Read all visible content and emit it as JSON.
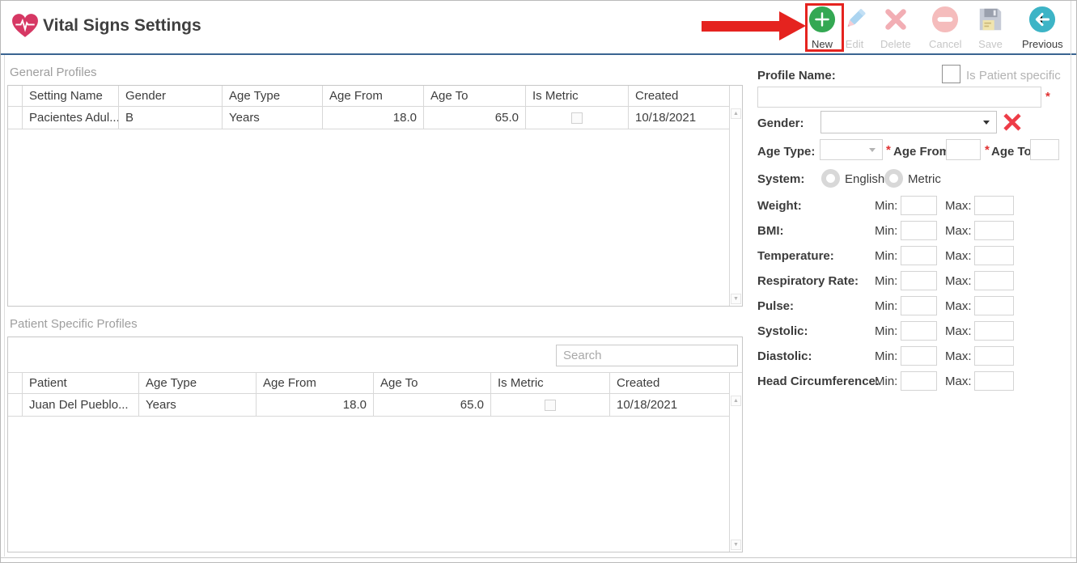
{
  "header": {
    "title": "Vital Signs Settings"
  },
  "toolbar": {
    "new": {
      "label": "New",
      "enabled": true
    },
    "edit": {
      "label": "Edit",
      "enabled": false
    },
    "delete": {
      "label": "Delete",
      "enabled": false
    },
    "cancel": {
      "label": "Cancel",
      "enabled": false
    },
    "save": {
      "label": "Save",
      "enabled": false
    },
    "previous": {
      "label": "Previous",
      "enabled": true
    }
  },
  "annotation": {
    "highlighted_button": "New"
  },
  "general_profiles": {
    "title": "General Profiles",
    "columns": [
      "Setting Name",
      "Gender",
      "Age Type",
      "Age From",
      "Age To",
      "Is Metric",
      "Created"
    ],
    "rows": [
      {
        "setting_name": "Pacientes Adul...",
        "gender": "B",
        "age_type": "Years",
        "age_from": "18.0",
        "age_to": "65.0",
        "is_metric": false,
        "created": "10/18/2021"
      }
    ]
  },
  "patient_profiles": {
    "title": "Patient Specific Profiles",
    "search_placeholder": "Search",
    "columns": [
      "Patient",
      "Age Type",
      "Age From",
      "Age To",
      "Is Metric",
      "Created"
    ],
    "rows": [
      {
        "patient": "Juan Del Pueblo...",
        "age_type": "Years",
        "age_from": "18.0",
        "age_to": "65.0",
        "is_metric": false,
        "created": "10/18/2021"
      }
    ]
  },
  "form": {
    "profile_name_label": "Profile Name:",
    "is_patient_specific_label": "Is Patient specific",
    "is_patient_specific_checked": false,
    "profile_name_value": "",
    "required_marker": "*",
    "gender_label": "Gender:",
    "gender_value": "",
    "age_type_label": "Age Type:",
    "age_type_value": "",
    "age_from_label": "Age From:",
    "age_from_value": "",
    "age_to_label": "Age To:",
    "age_to_value": "",
    "system_label": "System:",
    "system_options": [
      "English",
      "Metric"
    ],
    "system_selected": "",
    "min_label": "Min:",
    "max_label": "Max:",
    "metrics": [
      {
        "label": "Weight:",
        "min": "",
        "max": ""
      },
      {
        "label": "BMI:",
        "min": "",
        "max": ""
      },
      {
        "label": "Temperature:",
        "min": "",
        "max": ""
      },
      {
        "label": "Respiratory Rate:",
        "min": "",
        "max": ""
      },
      {
        "label": "Pulse:",
        "min": "",
        "max": ""
      },
      {
        "label": "Systolic:",
        "min": "",
        "max": ""
      },
      {
        "label": "Diastolic:",
        "min": "",
        "max": ""
      },
      {
        "label": "Head Circumference:",
        "min": "",
        "max": ""
      }
    ]
  },
  "colors": {
    "new_button": "#34a853",
    "previous_button": "#3db4c6",
    "heart": "#d63864",
    "annotation_red": "#e5231f",
    "separator_blue": "#3a6491",
    "required_red": "#e03131",
    "disabled_pink": "#f2aeb4"
  }
}
